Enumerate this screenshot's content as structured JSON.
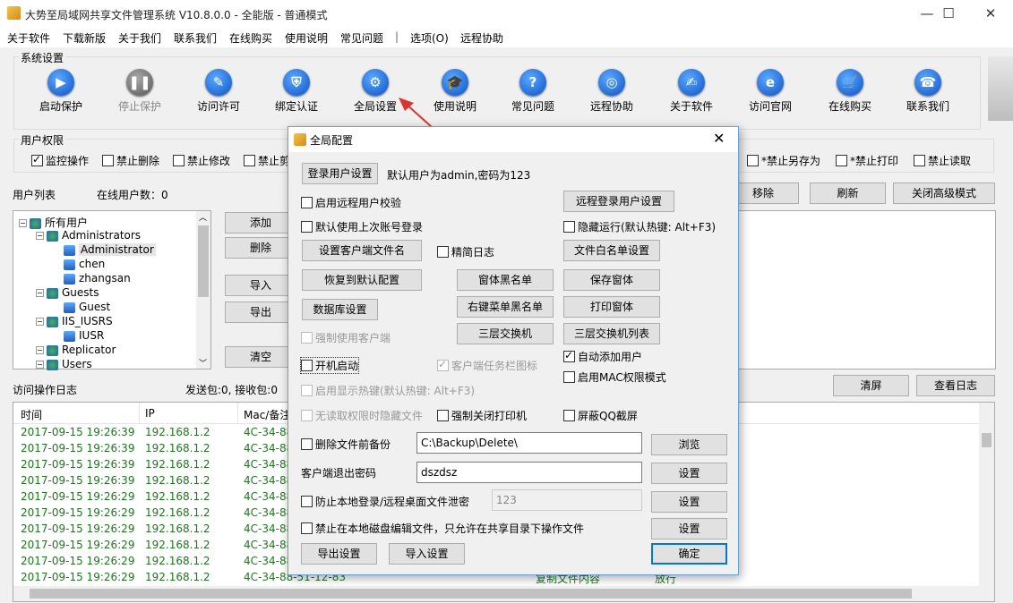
{
  "app": {
    "title": "大势至局域网共享文件管理系统 V10.8.0.0 - 全能版 - 普通模式",
    "win_min": "—",
    "win_max": "☐",
    "win_close": "✕"
  },
  "menu": [
    "关于软件",
    "下载新版",
    "关于我们",
    "联系我们",
    "在线购买",
    "使用说明",
    "常见问题",
    "|",
    "选项(O)",
    "远程协助"
  ],
  "system": {
    "group_label": "系统设置",
    "buttons": [
      {
        "label": "启动保护",
        "icon": "play-icon",
        "glyph": "▶"
      },
      {
        "label": "停止保护",
        "icon": "pause-icon",
        "glyph": "❚❚"
      },
      {
        "label": "访问许可",
        "icon": "key-icon",
        "glyph": "✎"
      },
      {
        "label": "绑定认证",
        "icon": "shield-icon",
        "glyph": "⛨"
      },
      {
        "label": "全局设置",
        "icon": "gear-icon",
        "glyph": "⚙"
      },
      {
        "label": "使用说明",
        "icon": "graduation-cap-icon",
        "glyph": "🎓"
      },
      {
        "label": "常见问题",
        "icon": "question-icon",
        "glyph": "?"
      },
      {
        "label": "远程协助",
        "icon": "globe-icon",
        "glyph": "◎"
      },
      {
        "label": "关于软件",
        "icon": "document-edit-icon",
        "glyph": "✍"
      },
      {
        "label": "访问官网",
        "icon": "browser-icon",
        "glyph": "e"
      },
      {
        "label": "在线购买",
        "icon": "cart-icon",
        "glyph": "🛒"
      },
      {
        "label": "联系我们",
        "icon": "phone-icon",
        "glyph": "☎"
      }
    ]
  },
  "permissions": {
    "group_label": "用户权限",
    "left_items": [
      {
        "label": "监控操作",
        "checked": true
      },
      {
        "label": "禁止删除",
        "checked": false
      },
      {
        "label": "禁止修改",
        "checked": false
      },
      {
        "label": "禁止剪",
        "checked": false
      }
    ],
    "right_items": [
      {
        "label": "*禁止另存为",
        "checked": false
      },
      {
        "label": "*禁止打印",
        "checked": false
      },
      {
        "label": "禁止读取",
        "checked": false
      }
    ]
  },
  "users": {
    "list_label": "用户列表",
    "online_label": "在线用户数：0",
    "tree": [
      {
        "label": "所有用户",
        "level": 0,
        "kind": "root"
      },
      {
        "label": "Administrators",
        "level": 1,
        "kind": "group"
      },
      {
        "label": "Administrator",
        "level": 2,
        "kind": "user",
        "selected": true
      },
      {
        "label": "chen",
        "level": 2,
        "kind": "user"
      },
      {
        "label": "zhangsan",
        "level": 2,
        "kind": "user"
      },
      {
        "label": "Guests",
        "level": 1,
        "kind": "group"
      },
      {
        "label": "Guest",
        "level": 2,
        "kind": "user"
      },
      {
        "label": "IIS_IUSRS",
        "level": 1,
        "kind": "group"
      },
      {
        "label": "IUSR",
        "level": 2,
        "kind": "user"
      },
      {
        "label": "Replicator",
        "level": 1,
        "kind": "group"
      },
      {
        "label": "Users",
        "level": 1,
        "kind": "group"
      }
    ],
    "buttons": {
      "add": "添加",
      "del": "删除",
      "import": "导入",
      "export": "导出",
      "clear": "清空"
    },
    "right_buttons": {
      "remove": "移除",
      "refresh": "刷新",
      "close_adv": "关闭高级模式"
    }
  },
  "log": {
    "label": "访问操作日志",
    "stats": "发送包:0, 接收包:0",
    "clear_btn": "清屏",
    "view_btn": "查看日志",
    "columns": [
      "时间",
      "IP",
      "Mac/备注"
    ],
    "rows": [
      [
        "2017-09-15 19:26:39",
        "192.168.1.2",
        "4C-34-88"
      ],
      [
        "2017-09-15 19:26:39",
        "192.168.1.2",
        "4C-34-88"
      ],
      [
        "2017-09-15 19:26:39",
        "192.168.1.2",
        "4C-34-88"
      ],
      [
        "2017-09-15 19:26:39",
        "192.168.1.2",
        "4C-34-88"
      ],
      [
        "2017-09-15 19:26:29",
        "192.168.1.2",
        "4C-34-88"
      ],
      [
        "2017-09-15 19:26:29",
        "192.168.1.2",
        "4C-34-88"
      ],
      [
        "2017-09-15 19:26:29",
        "192.168.1.2",
        "4C-34-88"
      ],
      [
        "2017-09-15 19:26:29",
        "192.168.1.2",
        "4C-34-88"
      ],
      [
        "2017-09-15 19:26:29",
        "192.168.1.2",
        "4C-34-88"
      ],
      [
        "2017-09-15 19:26:29",
        "192.168.1.2",
        "4C-34-88-51-12-83"
      ]
    ],
    "last_row_extra": {
      "op": "复制文件内容",
      "result": "放行"
    }
  },
  "dialog": {
    "title": "全局配置",
    "close": "✕",
    "login_btn": "登录用户设置",
    "login_hint": "默认用户为admin,密码为123",
    "remote_login_btn": "远程登录用户设置",
    "cb_remote_verify": {
      "label": "启用远程用户校验",
      "checked": false
    },
    "cb_last_account": {
      "label": "默认使用上次账号登录",
      "checked": false
    },
    "cb_hide_run": {
      "label": "隐藏运行(默认热键: Alt+F3)",
      "checked": false
    },
    "set_client_file_btn": "设置客户端文件名",
    "cb_precise_log": {
      "label": "精简日志",
      "checked": false
    },
    "file_whitelist_btn": "文件白名单设置",
    "restore_btn": "恢复到默认配置",
    "window_blacklist_btn": "窗体黑名单",
    "save_window_btn": "保存窗体",
    "db_btn": "数据库设置",
    "rclick_blacklist_btn": "右键菜单黑名单",
    "print_window_btn": "打印窗体",
    "l3_switch_btn": "三层交换机",
    "l3_switch_list_btn": "三层交换机列表",
    "cb_force_client": {
      "label": "强制使用客户端",
      "checked": false,
      "disabled": true
    },
    "cb_auto_add": {
      "label": "自动添加用户",
      "checked": true
    },
    "cb_boot_start": {
      "label": "开机启动",
      "checked": false
    },
    "cb_tray_icon": {
      "label": "客户端任务栏图标",
      "checked": true,
      "disabled": true
    },
    "cb_mac_mode": {
      "label": "启用MAC权限模式",
      "checked": false
    },
    "cb_hotkey": {
      "label": "启用显示热键(默认热键: Alt+F3)",
      "checked": false,
      "disabled": true
    },
    "cb_hide_no_read": {
      "label": "无读取权限时隐藏文件",
      "checked": false,
      "disabled": true
    },
    "cb_force_close_printer": {
      "label": "强制关闭打印机",
      "checked": false
    },
    "cb_block_qq": {
      "label": "屏蔽QQ截屏",
      "checked": false
    },
    "cb_backup": {
      "label": "删除文件前备份",
      "checked": false
    },
    "backup_path": "C:\\Backup\\Delete\\",
    "browse_btn": "浏览",
    "exit_pwd_label": "客户端退出密码",
    "exit_pwd": "dszdsz",
    "set_btn": "设置",
    "cb_leak": {
      "label": "防止本地登录/远程桌面文件泄密",
      "checked": false
    },
    "leak_value": "123",
    "cb_local_disk": {
      "label": "禁止在本地磁盘编辑文件，只允许在共享目录下操作文件",
      "checked": false
    },
    "export_btn": "导出设置",
    "import_btn": "导入设置",
    "ok_btn": "确定"
  }
}
